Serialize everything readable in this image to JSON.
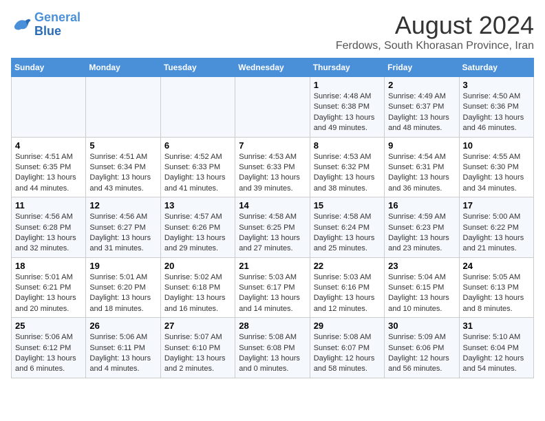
{
  "header": {
    "logo_line1": "General",
    "logo_line2": "Blue",
    "main_title": "August 2024",
    "subtitle": "Ferdows, South Khorasan Province, Iran"
  },
  "days_of_week": [
    "Sunday",
    "Monday",
    "Tuesday",
    "Wednesday",
    "Thursday",
    "Friday",
    "Saturday"
  ],
  "weeks": [
    [
      {
        "num": "",
        "info": ""
      },
      {
        "num": "",
        "info": ""
      },
      {
        "num": "",
        "info": ""
      },
      {
        "num": "",
        "info": ""
      },
      {
        "num": "1",
        "info": "Sunrise: 4:48 AM\nSunset: 6:38 PM\nDaylight: 13 hours\nand 49 minutes."
      },
      {
        "num": "2",
        "info": "Sunrise: 4:49 AM\nSunset: 6:37 PM\nDaylight: 13 hours\nand 48 minutes."
      },
      {
        "num": "3",
        "info": "Sunrise: 4:50 AM\nSunset: 6:36 PM\nDaylight: 13 hours\nand 46 minutes."
      }
    ],
    [
      {
        "num": "4",
        "info": "Sunrise: 4:51 AM\nSunset: 6:35 PM\nDaylight: 13 hours\nand 44 minutes."
      },
      {
        "num": "5",
        "info": "Sunrise: 4:51 AM\nSunset: 6:34 PM\nDaylight: 13 hours\nand 43 minutes."
      },
      {
        "num": "6",
        "info": "Sunrise: 4:52 AM\nSunset: 6:33 PM\nDaylight: 13 hours\nand 41 minutes."
      },
      {
        "num": "7",
        "info": "Sunrise: 4:53 AM\nSunset: 6:33 PM\nDaylight: 13 hours\nand 39 minutes."
      },
      {
        "num": "8",
        "info": "Sunrise: 4:53 AM\nSunset: 6:32 PM\nDaylight: 13 hours\nand 38 minutes."
      },
      {
        "num": "9",
        "info": "Sunrise: 4:54 AM\nSunset: 6:31 PM\nDaylight: 13 hours\nand 36 minutes."
      },
      {
        "num": "10",
        "info": "Sunrise: 4:55 AM\nSunset: 6:30 PM\nDaylight: 13 hours\nand 34 minutes."
      }
    ],
    [
      {
        "num": "11",
        "info": "Sunrise: 4:56 AM\nSunset: 6:28 PM\nDaylight: 13 hours\nand 32 minutes."
      },
      {
        "num": "12",
        "info": "Sunrise: 4:56 AM\nSunset: 6:27 PM\nDaylight: 13 hours\nand 31 minutes."
      },
      {
        "num": "13",
        "info": "Sunrise: 4:57 AM\nSunset: 6:26 PM\nDaylight: 13 hours\nand 29 minutes."
      },
      {
        "num": "14",
        "info": "Sunrise: 4:58 AM\nSunset: 6:25 PM\nDaylight: 13 hours\nand 27 minutes."
      },
      {
        "num": "15",
        "info": "Sunrise: 4:58 AM\nSunset: 6:24 PM\nDaylight: 13 hours\nand 25 minutes."
      },
      {
        "num": "16",
        "info": "Sunrise: 4:59 AM\nSunset: 6:23 PM\nDaylight: 13 hours\nand 23 minutes."
      },
      {
        "num": "17",
        "info": "Sunrise: 5:00 AM\nSunset: 6:22 PM\nDaylight: 13 hours\nand 21 minutes."
      }
    ],
    [
      {
        "num": "18",
        "info": "Sunrise: 5:01 AM\nSunset: 6:21 PM\nDaylight: 13 hours\nand 20 minutes."
      },
      {
        "num": "19",
        "info": "Sunrise: 5:01 AM\nSunset: 6:20 PM\nDaylight: 13 hours\nand 18 minutes."
      },
      {
        "num": "20",
        "info": "Sunrise: 5:02 AM\nSunset: 6:18 PM\nDaylight: 13 hours\nand 16 minutes."
      },
      {
        "num": "21",
        "info": "Sunrise: 5:03 AM\nSunset: 6:17 PM\nDaylight: 13 hours\nand 14 minutes."
      },
      {
        "num": "22",
        "info": "Sunrise: 5:03 AM\nSunset: 6:16 PM\nDaylight: 13 hours\nand 12 minutes."
      },
      {
        "num": "23",
        "info": "Sunrise: 5:04 AM\nSunset: 6:15 PM\nDaylight: 13 hours\nand 10 minutes."
      },
      {
        "num": "24",
        "info": "Sunrise: 5:05 AM\nSunset: 6:13 PM\nDaylight: 13 hours\nand 8 minutes."
      }
    ],
    [
      {
        "num": "25",
        "info": "Sunrise: 5:06 AM\nSunset: 6:12 PM\nDaylight: 13 hours\nand 6 minutes."
      },
      {
        "num": "26",
        "info": "Sunrise: 5:06 AM\nSunset: 6:11 PM\nDaylight: 13 hours\nand 4 minutes."
      },
      {
        "num": "27",
        "info": "Sunrise: 5:07 AM\nSunset: 6:10 PM\nDaylight: 13 hours\nand 2 minutes."
      },
      {
        "num": "28",
        "info": "Sunrise: 5:08 AM\nSunset: 6:08 PM\nDaylight: 13 hours\nand 0 minutes."
      },
      {
        "num": "29",
        "info": "Sunrise: 5:08 AM\nSunset: 6:07 PM\nDaylight: 12 hours\nand 58 minutes."
      },
      {
        "num": "30",
        "info": "Sunrise: 5:09 AM\nSunset: 6:06 PM\nDaylight: 12 hours\nand 56 minutes."
      },
      {
        "num": "31",
        "info": "Sunrise: 5:10 AM\nSunset: 6:04 PM\nDaylight: 12 hours\nand 54 minutes."
      }
    ]
  ]
}
